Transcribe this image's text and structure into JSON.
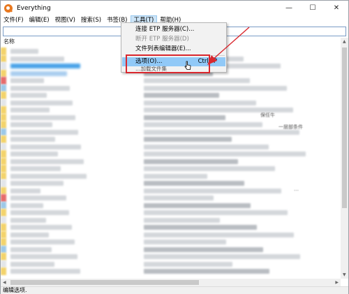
{
  "window": {
    "title": "Everything",
    "controls": {
      "minimize": "—",
      "maximize": "☐",
      "close": "✕"
    }
  },
  "menubar": {
    "items": [
      {
        "label": "文件(F)"
      },
      {
        "label": "编辑(E)"
      },
      {
        "label": "视图(V)"
      },
      {
        "label": "搜索(S)"
      },
      {
        "label": "书签(B)"
      },
      {
        "label": "工具(T)"
      },
      {
        "label": "帮助(H)"
      }
    ]
  },
  "list": {
    "column_name": "名称",
    "fragments": [
      "保任牛",
      "一层部条件",
      "…"
    ]
  },
  "tools_menu": {
    "items": [
      {
        "label": "连接 ETP 服务器(C)..."
      },
      {
        "label": "断开 ETP 服务器(D)"
      },
      {
        "label": "文件列表编辑器(E)..."
      },
      {
        "label": "选项(O)...",
        "shortcut": "Ctrl+P"
      },
      {
        "label": "…加载文件集"
      }
    ]
  },
  "statusbar": {
    "text": "编辑选项."
  },
  "colors": {
    "annotation": "#d9272e",
    "menu_hover": "#91c9f7",
    "selection": "#4aa3e8"
  }
}
